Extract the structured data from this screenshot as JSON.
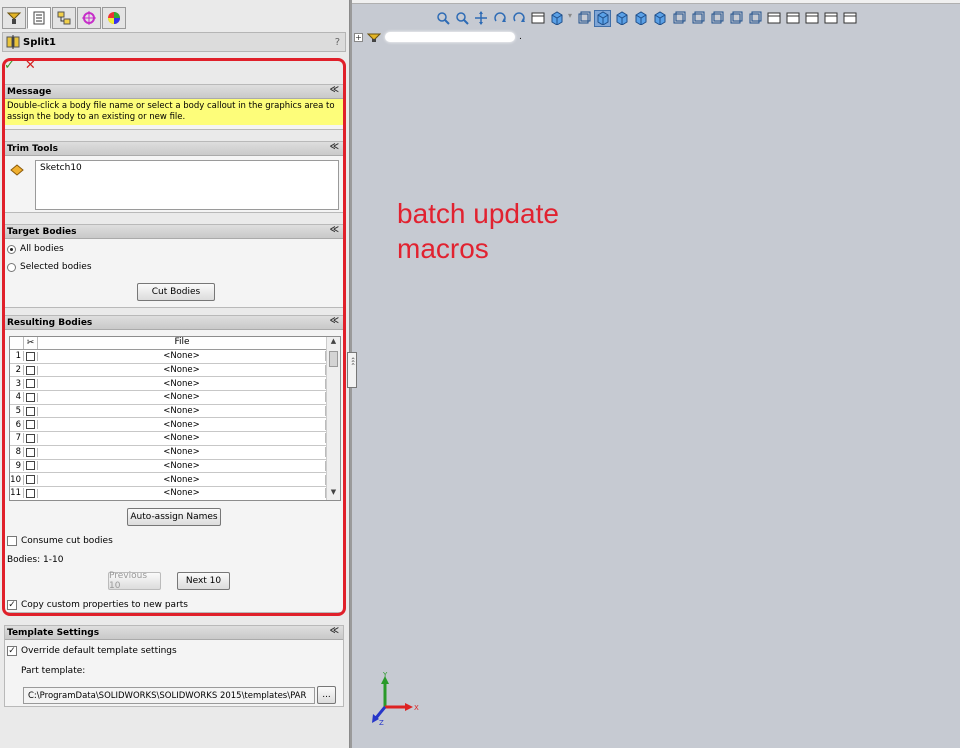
{
  "panel": {
    "title": "Split1",
    "help_label": "?",
    "ok_glyph": "✓",
    "cancel_glyph": "✕",
    "tabs": [
      {
        "icon": "feature-manager-icon"
      },
      {
        "icon": "property-manager-icon"
      },
      {
        "icon": "configuration-manager-icon"
      },
      {
        "icon": "dimxpert-manager-icon"
      },
      {
        "icon": "display-manager-icon"
      }
    ]
  },
  "message": {
    "header": "Message",
    "text": "Double-click a body file name or select a body callout in the graphics area to assign the body to an existing or new file.",
    "color": "#fdfd7a"
  },
  "trim_tools": {
    "header": "Trim Tools",
    "items": [
      "Sketch10"
    ]
  },
  "target_bodies": {
    "header": "Target Bodies",
    "options": [
      "All bodies",
      "Selected bodies"
    ],
    "selected": "All bodies",
    "cut_button": "Cut Bodies"
  },
  "resulting_bodies": {
    "header": "Resulting Bodies",
    "column_file": "File",
    "column_icon": "scissors-icon",
    "rows": [
      {
        "num": "1",
        "file": "<None>"
      },
      {
        "num": "2",
        "file": "<None>"
      },
      {
        "num": "3",
        "file": "<None>"
      },
      {
        "num": "4",
        "file": "<None>"
      },
      {
        "num": "5",
        "file": "<None>"
      },
      {
        "num": "6",
        "file": "<None>"
      },
      {
        "num": "7",
        "file": "<None>"
      },
      {
        "num": "8",
        "file": "<None>"
      },
      {
        "num": "9",
        "file": "<None>"
      },
      {
        "num": "10",
        "file": "<None>"
      },
      {
        "num": "11",
        "file": "<None>"
      }
    ],
    "auto_assign": "Auto-assign Names",
    "consume_label": "Consume cut bodies",
    "consume_checked": false,
    "bodies_range": "Bodies: 1-10",
    "prev_button": "Previous 10",
    "next_button": "Next 10",
    "copy_label": "Copy custom properties to new parts",
    "copy_checked": true
  },
  "template_settings": {
    "header": "Template Settings",
    "override_label": "Override default template settings",
    "override_checked": true,
    "part_template_label": "Part template:",
    "part_template_value": "C:\\ProgramData\\SOLIDWORKS\\SOLIDWORKS 2015\\templates\\PAR",
    "browse_button": "..."
  },
  "graphics": {
    "overlay_line1": "batch update",
    "overlay_line2": "macros",
    "overlay_color": "#e12230",
    "tree_expand": "+",
    "tree_suffix": ".",
    "axis_labels": {
      "x": "X",
      "y": "Y",
      "z": "Z"
    }
  },
  "handle_glyphs": "‹‹‹",
  "collapse_glyph": "≪",
  "toolbar_icons": [
    "zoom-to-fit-icon",
    "zoom-area-icon",
    "pan-icon",
    "rotate-icon",
    "rollback-icon",
    "section-view-icon",
    "view-orientation-icon",
    "front-view-icon",
    "back-view-icon",
    "left-view-icon",
    "right-view-icon",
    "top-view-icon",
    "bottom-view-icon",
    "isometric-view-icon",
    "trimetric-view-icon",
    "dimetric-view-icon",
    "normal-to-icon",
    "single-view-icon",
    "two-view-horizontal-icon",
    "two-view-vertical-icon",
    "four-view-icon",
    "link-views-icon"
  ]
}
